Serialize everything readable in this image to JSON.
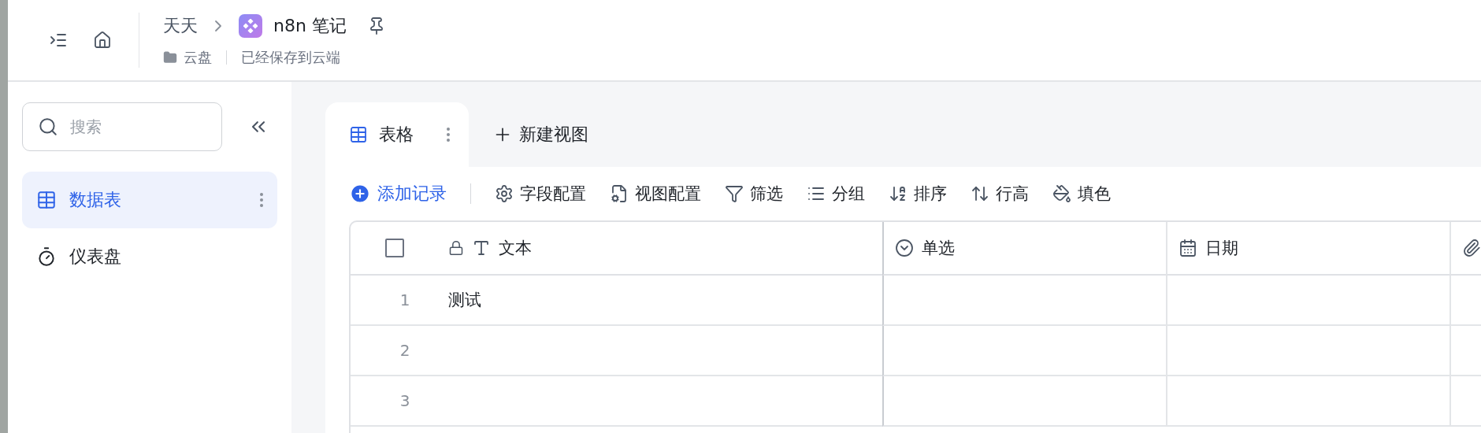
{
  "header": {
    "breadcrumb": [
      "天天"
    ],
    "title": "n8n 笔记",
    "location": "云盘",
    "save_status": "已经保存到云端"
  },
  "sidebar": {
    "search": {
      "placeholder": "搜索"
    },
    "items": [
      {
        "label": "数据表",
        "kind": "table",
        "selected": true
      },
      {
        "label": "仪表盘",
        "kind": "dashboard",
        "selected": false
      }
    ]
  },
  "view_tabs": [
    {
      "label": "表格",
      "selected": true
    }
  ],
  "new_view": "新建视图",
  "add_record": "添加记录",
  "toolbar": [
    {
      "label": "字段配置",
      "kind": "fields"
    },
    {
      "label": "视图配置",
      "kind": "view"
    },
    {
      "label": "筛选",
      "kind": "filter"
    },
    {
      "label": "分组",
      "kind": "group"
    },
    {
      "label": "排序",
      "kind": "sort"
    },
    {
      "label": "行高",
      "kind": "height"
    },
    {
      "label": "填色",
      "kind": "fill"
    }
  ],
  "table": {
    "select_all": {
      "checked": false
    },
    "columns": [
      {
        "label": "文本",
        "kind": "text",
        "locked": true
      },
      {
        "label": "单选",
        "kind": "select",
        "locked": false
      },
      {
        "label": "日期",
        "kind": "date",
        "locked": false
      },
      {
        "kind": "attachment",
        "locked": false
      }
    ],
    "rows": [
      {
        "number": "1",
        "cells": [
          "测试",
          "",
          ""
        ]
      },
      {
        "number": "2",
        "cells": [
          "",
          "",
          ""
        ]
      },
      {
        "number": "3",
        "cells": [
          "",
          "",
          ""
        ]
      }
    ]
  }
}
